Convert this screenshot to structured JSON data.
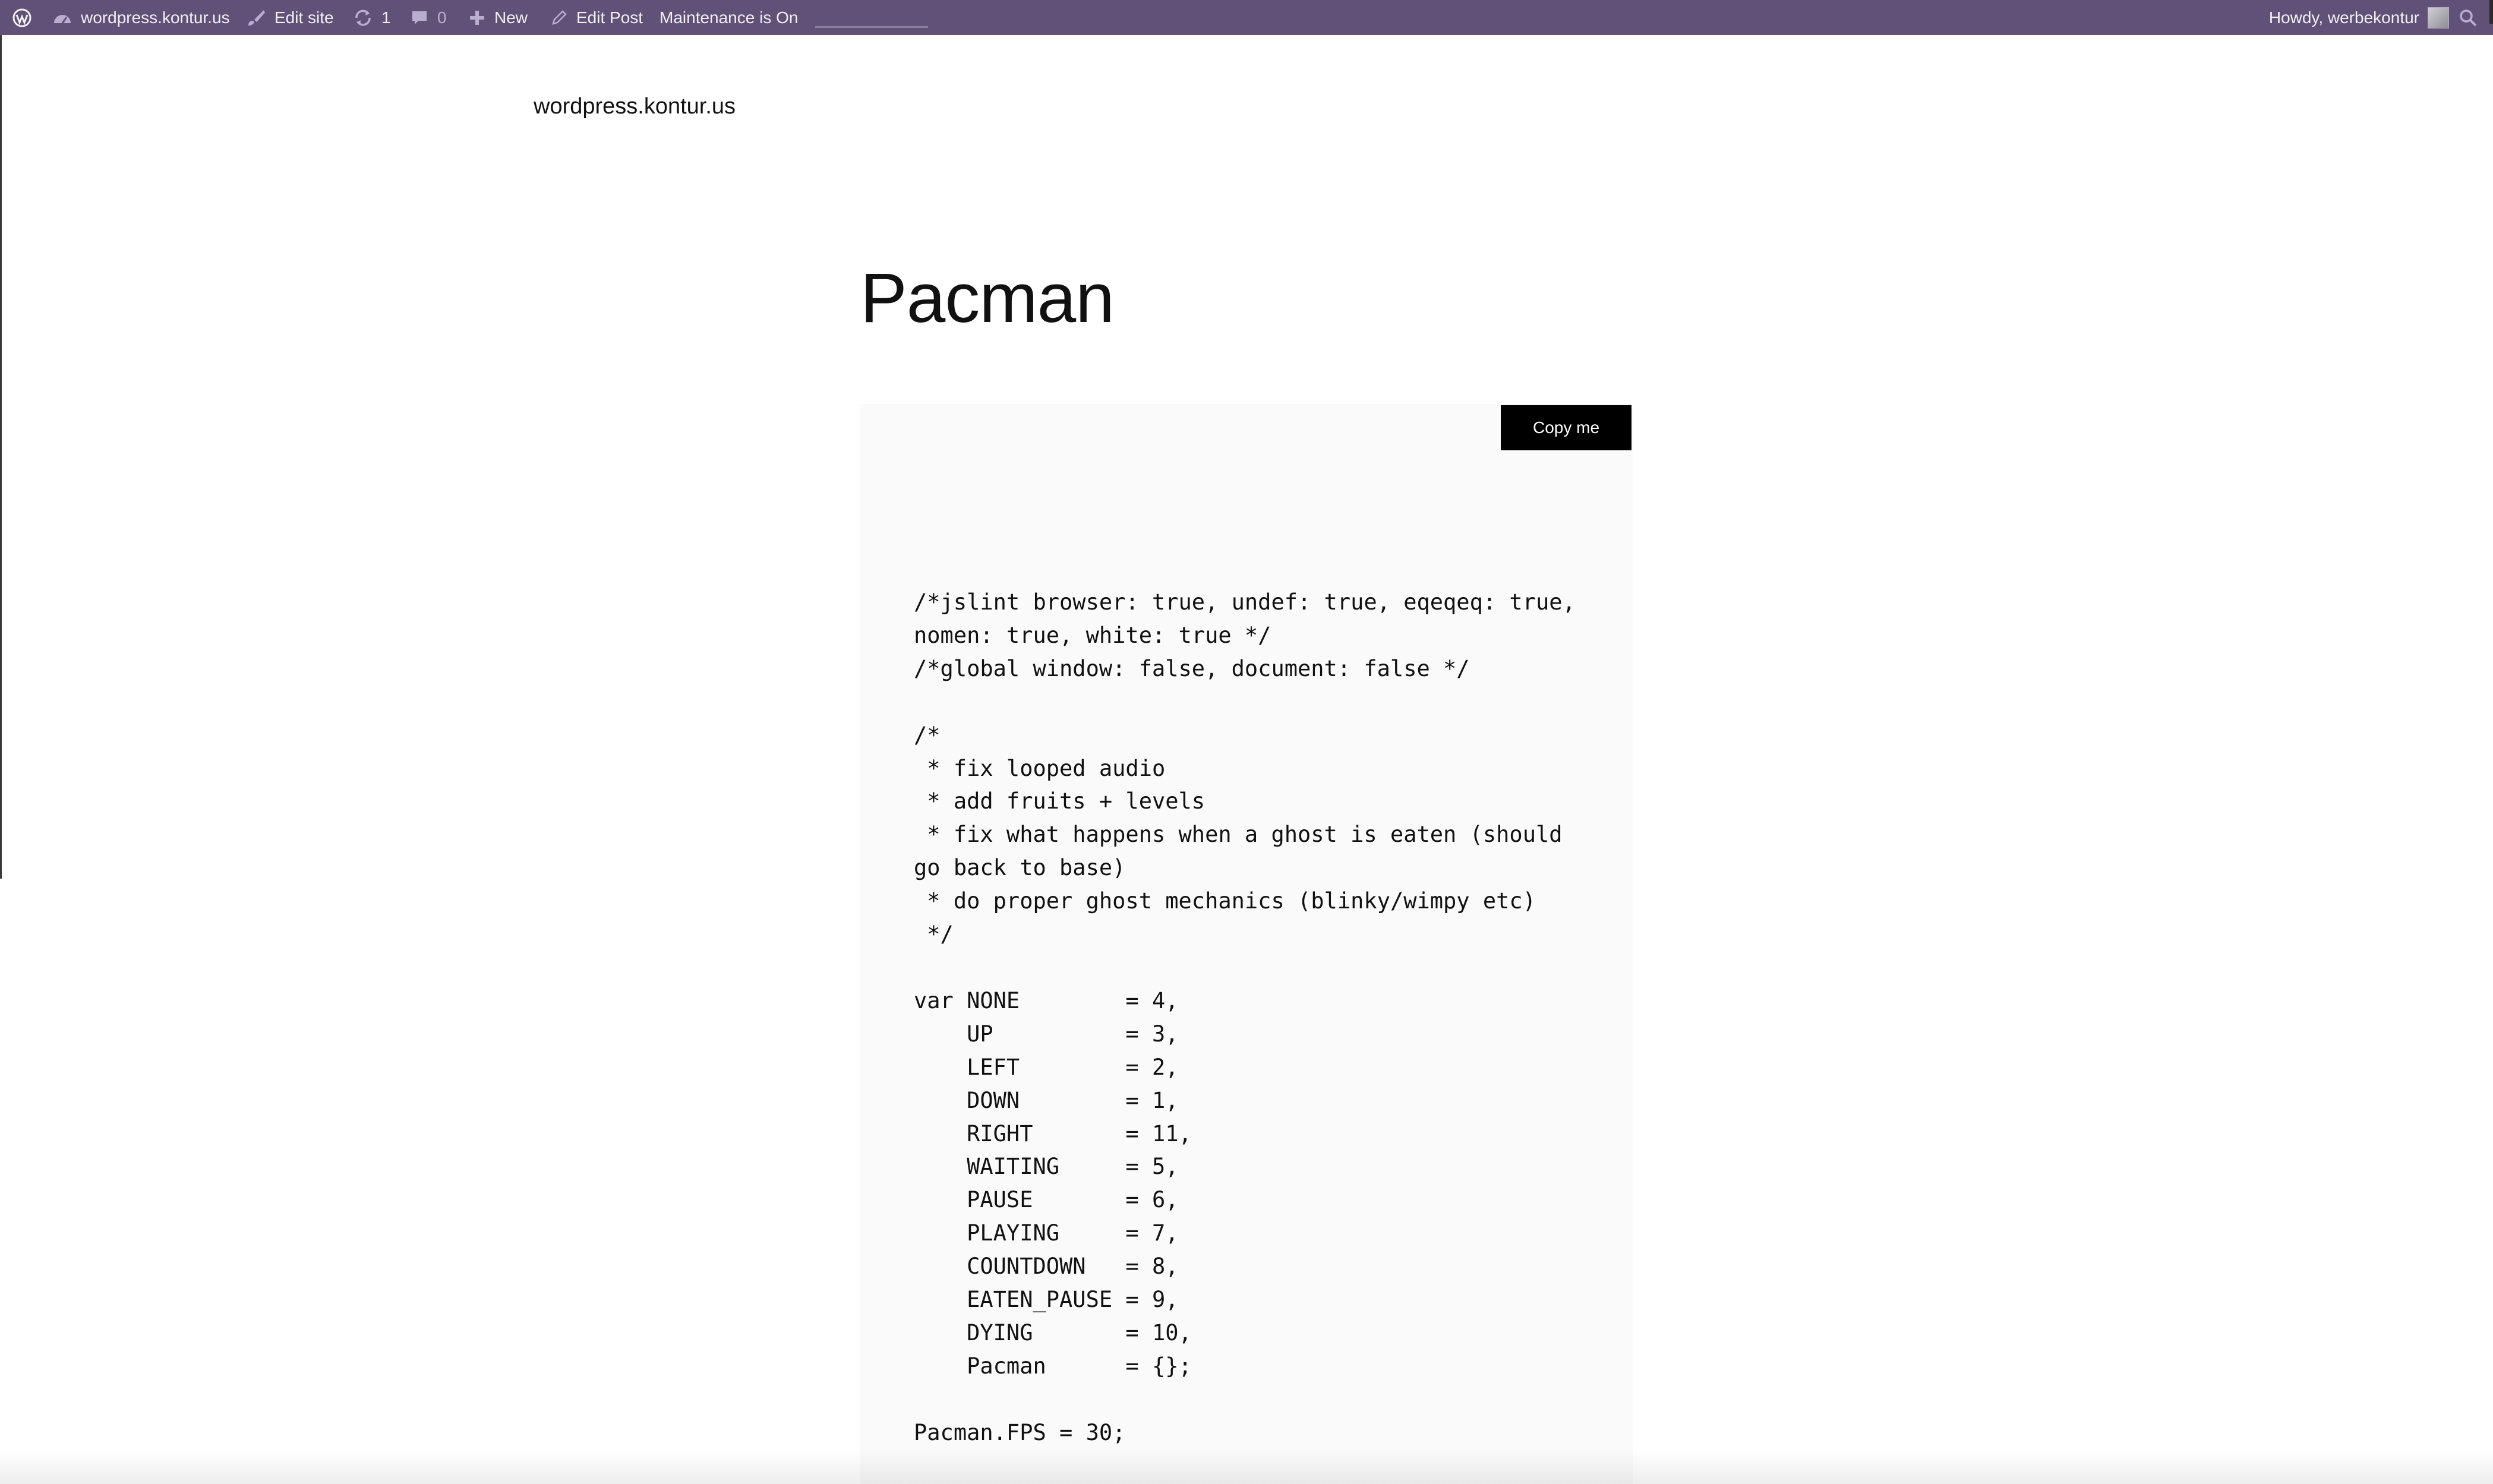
{
  "admin_bar": {
    "wp_logo_icon": "wordpress-logo-icon",
    "site_name": "wordpress.kontur.us",
    "edit_site": "Edit site",
    "updates_count": "1",
    "comments_count": "0",
    "new_label": "New",
    "edit_post": "Edit Post",
    "maintenance": "Maintenance is On",
    "greeting": "Howdy, werbekontur",
    "background_color": "#615178"
  },
  "site": {
    "title": "wordpress.kontur.us"
  },
  "post": {
    "title": "Pacman",
    "copy_button_label": "Copy me",
    "code": "/*jslint browser: true, undef: true, eqeqeq: true,\nnomen: true, white: true */\n/*global window: false, document: false */\n\n/*\n * fix looped audio\n * add fruits + levels\n * fix what happens when a ghost is eaten (should\ngo back to base)\n * do proper ghost mechanics (blinky/wimpy etc)\n */\n\nvar NONE        = 4,\n    UP          = 3,\n    LEFT        = 2,\n    DOWN        = 1,\n    RIGHT       = 11,\n    WAITING     = 5,\n    PAUSE       = 6,\n    PLAYING     = 7,\n    COUNTDOWN   = 8,\n    EATEN_PAUSE = 9,\n    DYING       = 10,\n    Pacman      = {};\n\nPacman.FPS = 30;"
  }
}
